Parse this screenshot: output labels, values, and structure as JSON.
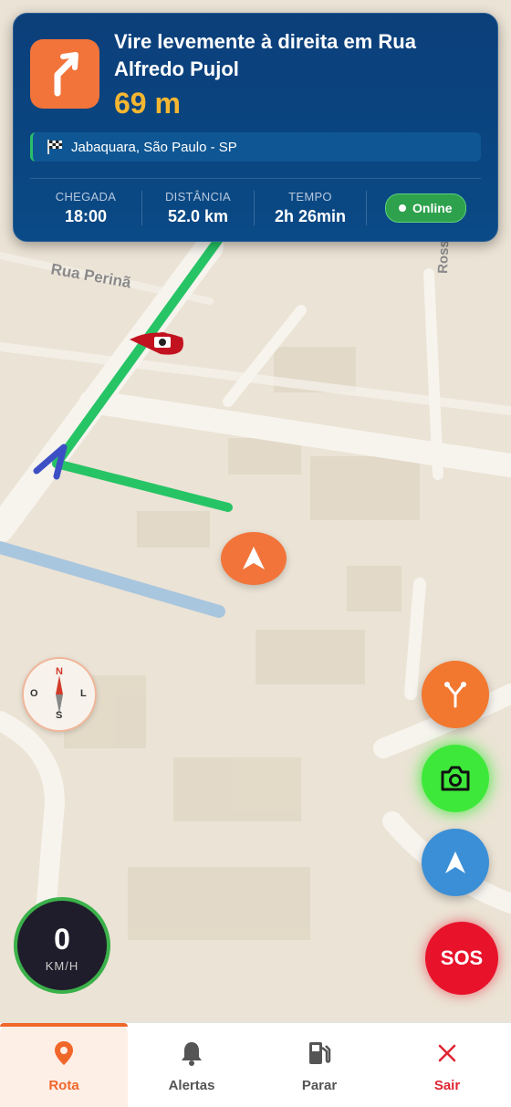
{
  "navigation": {
    "instruction": "Vire levemente à direita em Rua Alfredo Pujol",
    "distance": "69 m",
    "destination": "Jabaquara, São Paulo - SP",
    "stats": [
      {
        "label": "CHEGADA",
        "value": "18:00"
      },
      {
        "label": "DISTÂNCIA",
        "value": "52.0 km"
      },
      {
        "label": "TEMPO",
        "value": "2h 26min"
      }
    ],
    "status": "Online"
  },
  "map": {
    "street_labels": [
      "Rua Perinã",
      "Rossi"
    ]
  },
  "compass": {
    "n": "N",
    "s": "S",
    "o": "O",
    "l": "L"
  },
  "speed": {
    "value": "0",
    "unit": "KM/H"
  },
  "actions": {
    "sos_label": "SOS"
  },
  "bottom_nav": [
    {
      "label": "Rota",
      "icon": "location-pin-icon"
    },
    {
      "label": "Alertas",
      "icon": "bell-icon"
    },
    {
      "label": "Parar",
      "icon": "fuel-pump-icon"
    },
    {
      "label": "Sair",
      "icon": "close-icon"
    }
  ],
  "colors": {
    "accent": "#f0672a",
    "card": "#0b3f7a",
    "route": "#2ecc71",
    "sos": "#e8122b"
  }
}
